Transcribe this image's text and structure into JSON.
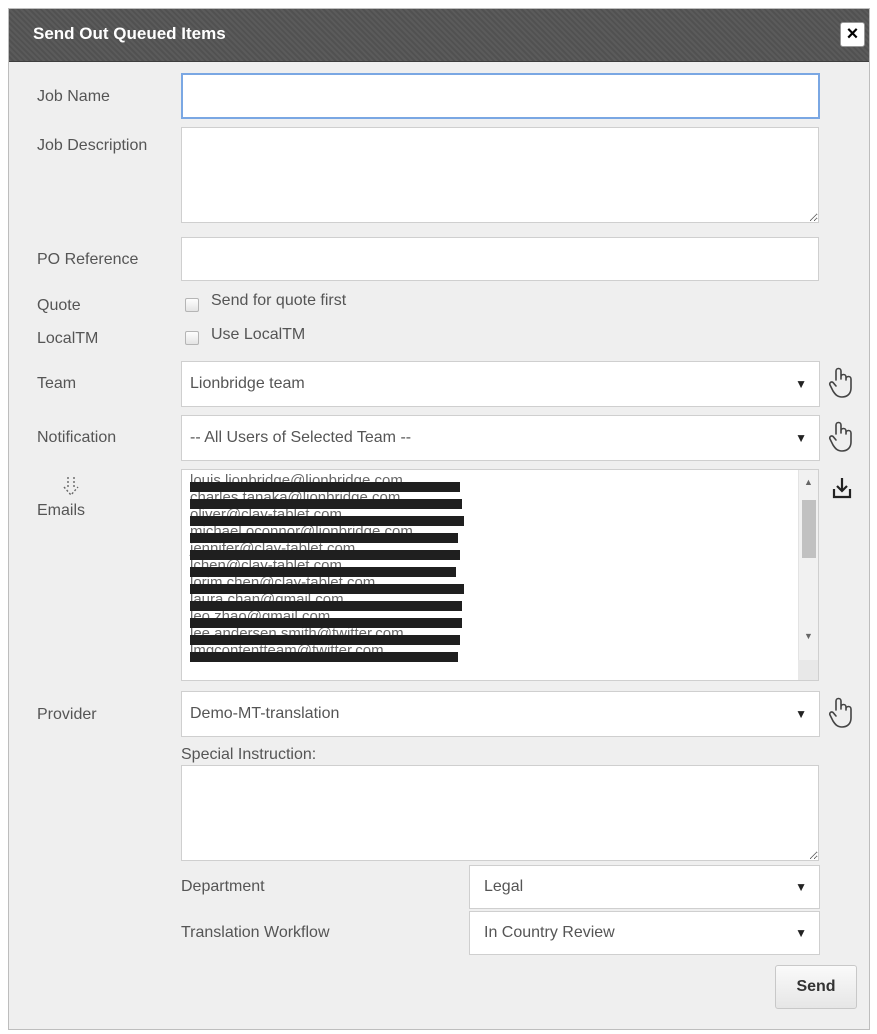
{
  "dialog": {
    "title": "Send Out Queued Items",
    "close_label": "×"
  },
  "fields": {
    "job_name": {
      "label": "Job Name",
      "value": ""
    },
    "job_description": {
      "label": "Job Description",
      "value": ""
    },
    "po_reference": {
      "label": "PO Reference",
      "value": ""
    },
    "quote": {
      "label": "Quote",
      "checkbox_label": "Send for quote first",
      "checked": false
    },
    "localtm": {
      "label": "LocalTM",
      "checkbox_label": "Use LocalTM",
      "checked": false
    },
    "team": {
      "label": "Team",
      "selected": "Lionbridge team"
    },
    "notification": {
      "label": "Notification",
      "selected": "-- All Users of Selected Team --"
    },
    "emails": {
      "label": "Emails",
      "lines": [
        "louis.lionbridge@lionbridge.com",
        "charles.tanaka@lionbridge.com",
        "oliver@clay-tablet.com",
        "michael.oconnor@lionbridge.com",
        "jennifer@clay-tablet.com",
        "lchen@clay-tablet.com",
        "lorim.chen@clay-tablet.com",
        "laura.chan@gmail.com",
        "leo.zhao@gmail.com",
        "lee.andersen.smith@twitter.com",
        "lmgcontentteam@twitter.com"
      ]
    },
    "provider": {
      "label": "Provider",
      "selected": "Demo-MT-translation"
    },
    "special_instruction": {
      "label": "Special Instruction:",
      "value": ""
    },
    "department": {
      "label": "Department",
      "selected": "Legal"
    },
    "translation_workflow": {
      "label": "Translation Workflow",
      "selected": "In Country Review"
    }
  },
  "actions": {
    "send_label": "Send"
  },
  "icons": {
    "hand": "pointer-hand-icon",
    "download": "download-icon",
    "expand": "expand-arrow-icon"
  }
}
